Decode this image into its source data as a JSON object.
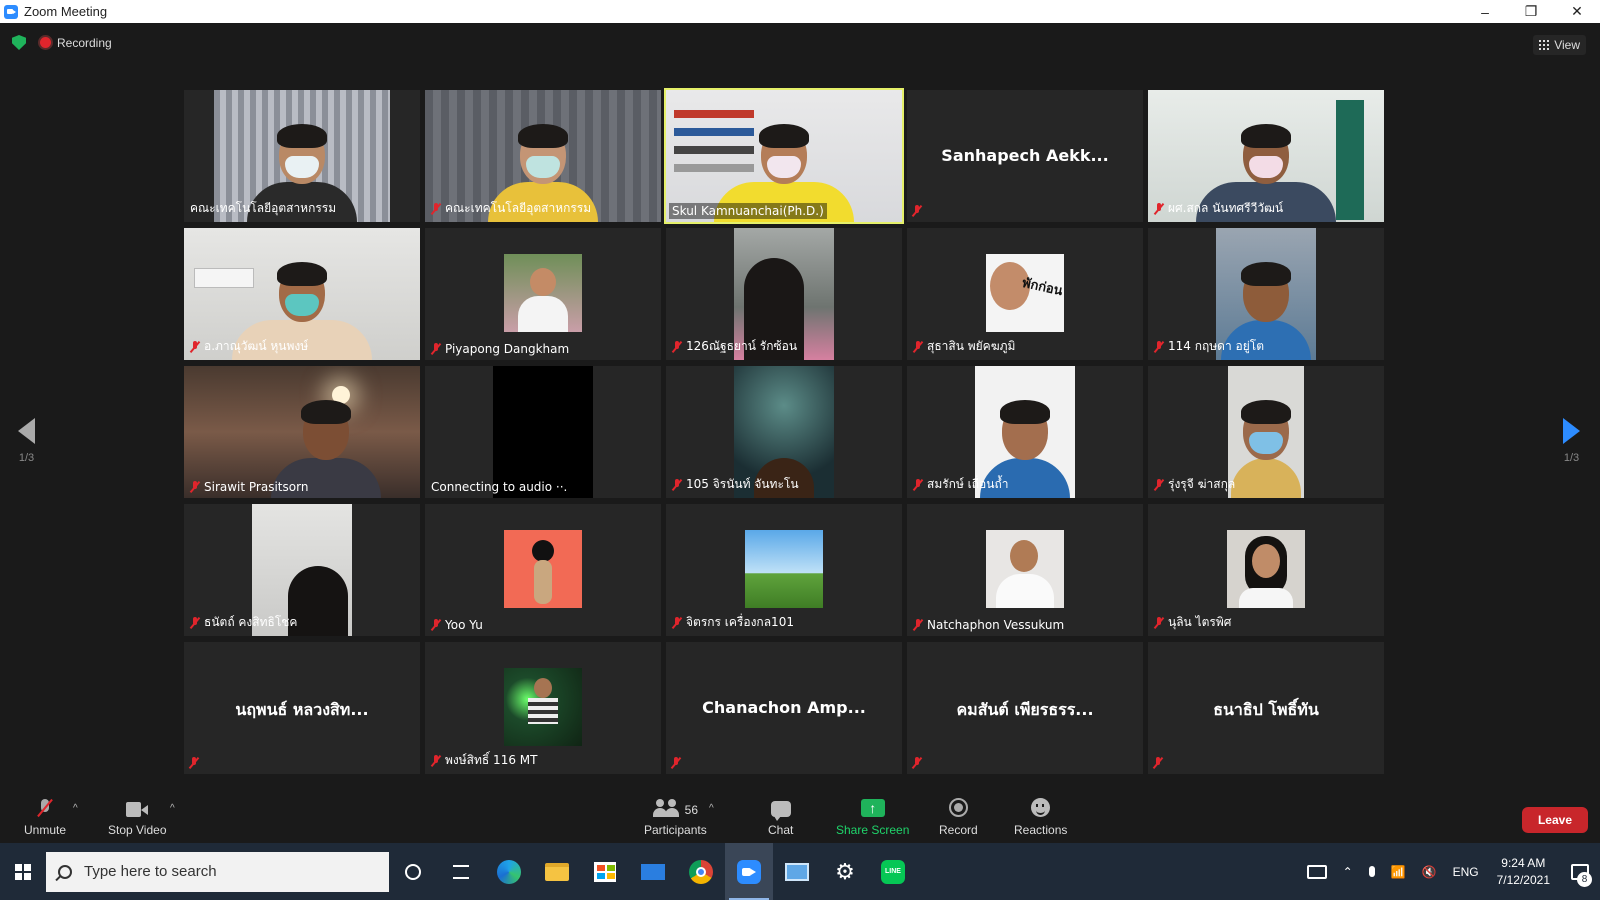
{
  "window": {
    "title": "Zoom Meeting",
    "minimize": "–",
    "maximize": "❐",
    "close": "✕"
  },
  "meeting": {
    "recording_label": "Recording",
    "view_label": "View",
    "page_left": "1/3",
    "page_right": "1/3"
  },
  "tiles": [
    {
      "label": "คณะเทคโนโลยีอุตสาหกรรม",
      "muted": false,
      "active": false
    },
    {
      "label": "คณะเทคโนโลยีอุตสาหกรรม",
      "muted": true,
      "active": false
    },
    {
      "label": "Skul Kamnuanchai(Ph.D.)",
      "muted": false,
      "active": true
    },
    {
      "center_name": "Sanhapech  Aekk...",
      "muted": true
    },
    {
      "label": "ผศ.สกล  นันทศรีวีวัฒน์",
      "muted": true
    },
    {
      "label": "อ.ภาณุวัฒน์  หุนพงษ์",
      "muted": true
    },
    {
      "label": "Piyapong Dangkham",
      "muted": true
    },
    {
      "label": "126ณัฐธยาน์ รักซ้อน",
      "muted": true
    },
    {
      "label": "สุธาสิน พยัคฆภูมิ",
      "muted": true
    },
    {
      "label": "114 กฤษดา อยู่โต",
      "muted": true
    },
    {
      "label": "Sirawit Prasitsorn",
      "muted": true
    },
    {
      "label": "Connecting to audio ··.",
      "muted": false
    },
    {
      "label": "105 จิรนันท์ จันทะโน",
      "muted": true
    },
    {
      "label": "สมรักษ์ เถื่อนถ้ำ",
      "muted": true
    },
    {
      "label": "รุ่งรุจี ฆ่าสกุล",
      "muted": true
    },
    {
      "label": "ธนัตถ์ คงสิทธิโชค",
      "muted": true
    },
    {
      "label": "Yoo Yu",
      "muted": true
    },
    {
      "label": "จิตรกร เครื่องกล101",
      "muted": true
    },
    {
      "label": "Natchaphon Vessukum",
      "muted": true
    },
    {
      "label": "นุลิน ไตรพิศ",
      "muted": true
    },
    {
      "center_name": "นฤพนธ์  หลวงสิท...",
      "muted": true
    },
    {
      "label": "พงษ์สิทธิ์ 116 MT",
      "muted": true
    },
    {
      "center_name": "Chanachon  Amp...",
      "muted": true
    },
    {
      "center_name": "คมสันต์ เพียรธรร...",
      "muted": true
    },
    {
      "center_name": "ธนาธิป โพธิ์ทัน",
      "muted": true
    }
  ],
  "controls": {
    "unmute": "Unmute",
    "stop_video": "Stop Video",
    "participants": "Participants",
    "participants_count": "56",
    "chat": "Chat",
    "share_screen": "Share Screen",
    "record": "Record",
    "reactions": "Reactions",
    "leave": "Leave",
    "caret": "^"
  },
  "taskbar": {
    "search_placeholder": "Type here to search",
    "language": "ENG",
    "time": "9:24 AM",
    "date": "7/12/2021",
    "notification_count": "8"
  },
  "colors": {
    "active_speaker": "#e5f06a",
    "muted_red": "#e0252c",
    "share_green": "#1fb35b",
    "leave_red": "#c8262b",
    "accent_blue": "#2d8cff"
  }
}
